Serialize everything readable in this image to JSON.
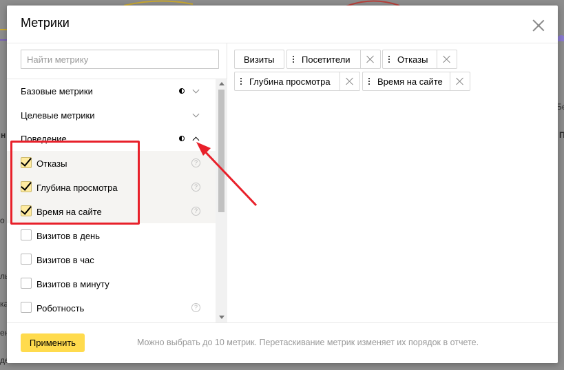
{
  "modal": {
    "title": "Метрики",
    "search_placeholder": "Найти метрику",
    "groups": [
      {
        "label": "Базовые метрики"
      },
      {
        "label": "Целевые метрики"
      },
      {
        "label": "Поведение"
      }
    ],
    "items": [
      {
        "label": "Отказы",
        "checked": true
      },
      {
        "label": "Глубина просмотра",
        "checked": true
      },
      {
        "label": "Время на сайте",
        "checked": true
      },
      {
        "label": "Визитов в день",
        "checked": false
      },
      {
        "label": "Визитов в час",
        "checked": false
      },
      {
        "label": "Визитов в минуту",
        "checked": false
      },
      {
        "label": "Роботность",
        "checked": false
      }
    ],
    "chips": [
      {
        "label": "Визиты"
      },
      {
        "label": "Посетители"
      },
      {
        "label": "Отказы"
      },
      {
        "label": "Глубина просмотра"
      },
      {
        "label": "Время на сайте"
      }
    ],
    "apply_label": "Применить",
    "footer_note": "Можно выбрать до 10 метрик. Перетаскивание метрик изменяет их порядок в отчете."
  },
  "background": {
    "fragments": [
      "н",
      "о",
      "ль",
      "ка",
      "ен",
      "де",
      "П",
      "Бе"
    ]
  },
  "colors": {
    "accent_yellow": "#ffdb4d",
    "checkbox_checked": "#ffeba0",
    "annotation_red": "#e8202a"
  }
}
